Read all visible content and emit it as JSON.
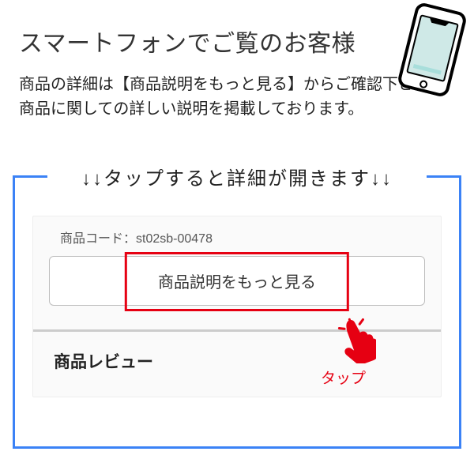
{
  "heading": "スマートフォンでご覧のお客様",
  "description_line1": "商品の詳細は【商品説明をもっと見る】からご確認下さい。",
  "description_line2": "商品に関しての詳しい説明を掲載しております。",
  "tap_callout": "↓↓タップすると詳細が開きます↓↓",
  "product_code_label": "商品コード：",
  "product_code_value": "st02sb-00478",
  "more_button_label": "商品説明をもっと見る",
  "tap_label": "タップ",
  "review_heading": "商品レビュー"
}
